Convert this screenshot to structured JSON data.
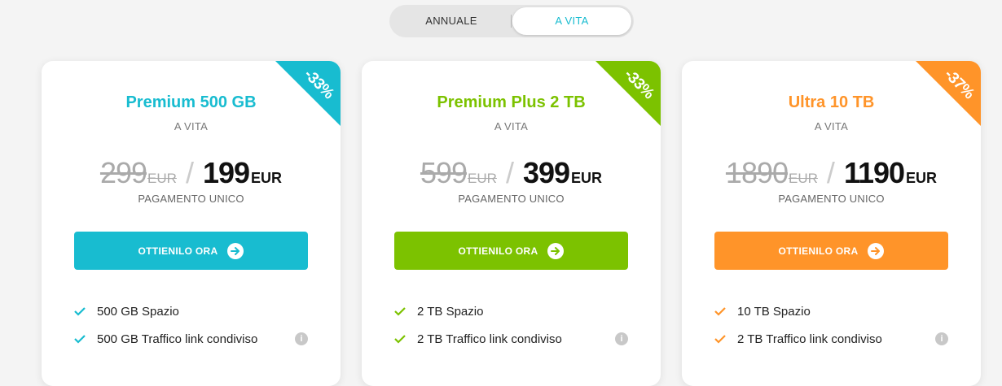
{
  "toggle": {
    "annual_label": "ANNUALE",
    "lifetime_label": "A VITA",
    "selected": "A VITA"
  },
  "colors": {
    "plan1": "#18bcd0",
    "plan2": "#7cc200",
    "plan3": "#ff9429"
  },
  "plans": [
    {
      "name": "Premium 500 GB",
      "sub": "A VITA",
      "discount": "-33%",
      "old_price": "299",
      "old_currency": "EUR",
      "new_price": "199",
      "new_currency": "EUR",
      "payment": "PAGAMENTO UNICO",
      "cta": "OTTIENILO ORA",
      "features": [
        "500 GB Spazio",
        "500 GB Traffico link condiviso"
      ]
    },
    {
      "name": "Premium Plus 2 TB",
      "sub": "A VITA",
      "discount": "-33%",
      "old_price": "599",
      "old_currency": "EUR",
      "new_price": "399",
      "new_currency": "EUR",
      "payment": "PAGAMENTO UNICO",
      "cta": "OTTIENILO ORA",
      "features": [
        "2 TB Spazio",
        "2 TB Traffico link condiviso"
      ]
    },
    {
      "name": "Ultra 10 TB",
      "sub": "A VITA",
      "discount": "-37%",
      "old_price": "1890",
      "old_currency": "EUR",
      "new_price": "1190",
      "new_currency": "EUR",
      "payment": "PAGAMENTO UNICO",
      "cta": "OTTIENILO ORA",
      "features": [
        "10 TB Spazio",
        "2 TB Traffico link condiviso"
      ]
    }
  ]
}
